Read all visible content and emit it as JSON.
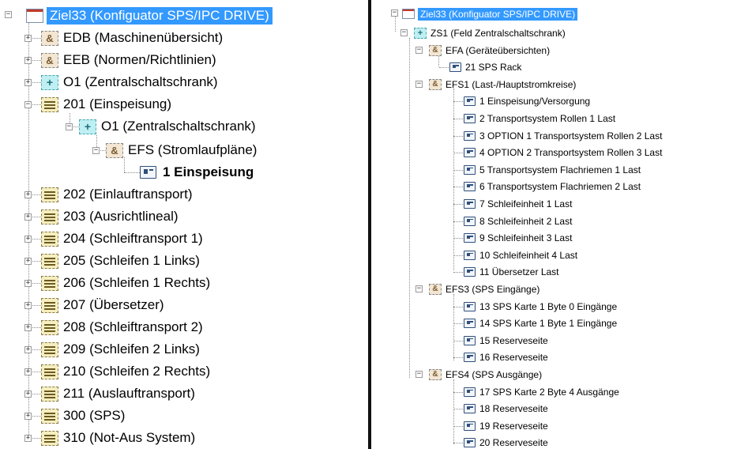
{
  "left_tree": {
    "root": "Ziel33 (Konfiguator SPS/IPC DRIVE)",
    "items": [
      "EDB (Maschinenübersicht)",
      "EEB (Normen/Richtlinien)",
      "O1 (Zentralschaltschrank)",
      "201 (Einspeisung)",
      "O1 (Zentralschaltschrank)",
      "EFS (Stromlaufpläne)",
      "1 Einspeisung",
      "202 (Einlauftransport)",
      "203 (Ausrichtlineal)",
      "204 (Schleiftransport 1)",
      "205 (Schleifen 1 Links)",
      "206 (Schleifen 1 Rechts)",
      "207 (Übersetzer)",
      "208 (Schleiftransport 2)",
      "209 (Schleifen 2 Links)",
      "210 (Schleifen 2 Rechts)",
      "211 (Auslauftransport)",
      "300 (SPS)",
      "310 (Not-Aus System)"
    ]
  },
  "right_tree": {
    "root": "Ziel33 (Konfiguator SPS/IPC DRIVE)",
    "items": [
      "ZS1 (Feld Zentralschaltschrank)",
      "EFA (Geräteübersichten)",
      "21 SPS Rack",
      "EFS1 (Last-/Hauptstromkreise)",
      "1 Einspeisung/Versorgung",
      "2 Transportsystem Rollen 1 Last",
      "3 OPTION 1 Transportsystem Rollen 2 Last",
      "4 OPTION 2 Transportsystem Rollen 3 Last",
      "5 Transportsystem Flachriemen 1 Last",
      "6 Transportsystem Flachriemen 2 Last",
      "7 Schleifeinheit 1 Last",
      "8 Schleifeinheit 2 Last",
      "9 Schleifeinheit 3 Last",
      "10 Schleifeinheit 4 Last",
      "11 Übersetzer Last",
      "EFS3 (SPS Eingänge)",
      "13 SPS Karte 1 Byte 0 Eingänge",
      "14 SPS Karte 1 Byte 1 Eingänge",
      "15 Reserveseite",
      "16 Reserveseite",
      "EFS4 (SPS Ausgänge)",
      "17 SPS Karte 2 Byte 4 Ausgänge",
      "18 Reserveseite",
      "19 Reserveseite",
      "20 Reserveseite"
    ]
  },
  "glyphs": {
    "collapsed": "+",
    "expanded": "−",
    "amp": "&",
    "plus": "+"
  },
  "colors": {
    "selection": "#3399ff",
    "selection_text": "#ffffff"
  }
}
